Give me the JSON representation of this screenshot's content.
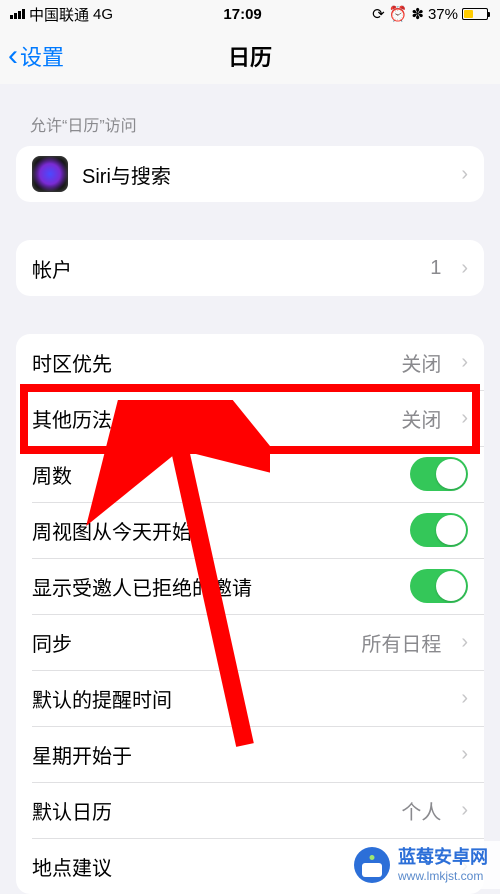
{
  "status": {
    "carrier": "中国联通",
    "network": "4G",
    "time": "17:09",
    "battery_pct": "37%"
  },
  "nav": {
    "back_label": "设置",
    "title": "日历"
  },
  "section_allow_label": "允许“日历”访问",
  "siri_row_label": "Siri与搜索",
  "accounts": {
    "label": "帐户",
    "value": "1"
  },
  "rows": {
    "timezone_override": {
      "label": "时区优先",
      "value": "关闭"
    },
    "alt_calendars": {
      "label": "其他历法",
      "value": "关闭"
    },
    "week_numbers": {
      "label": "周数"
    },
    "week_view_today": {
      "label": "周视图从今天开始"
    },
    "show_declined": {
      "label": "显示受邀人已拒绝的邀请"
    },
    "sync": {
      "label": "同步",
      "value": "所有日程"
    },
    "default_alert": {
      "label": "默认的提醒时间"
    },
    "week_start": {
      "label": "星期开始于"
    },
    "default_calendar": {
      "label": "默认日历",
      "value": "个人"
    },
    "location_suggest": {
      "label": "地点建议"
    }
  },
  "watermark": {
    "title": "蓝莓安卓网",
    "url": "www.lmkjst.com"
  }
}
